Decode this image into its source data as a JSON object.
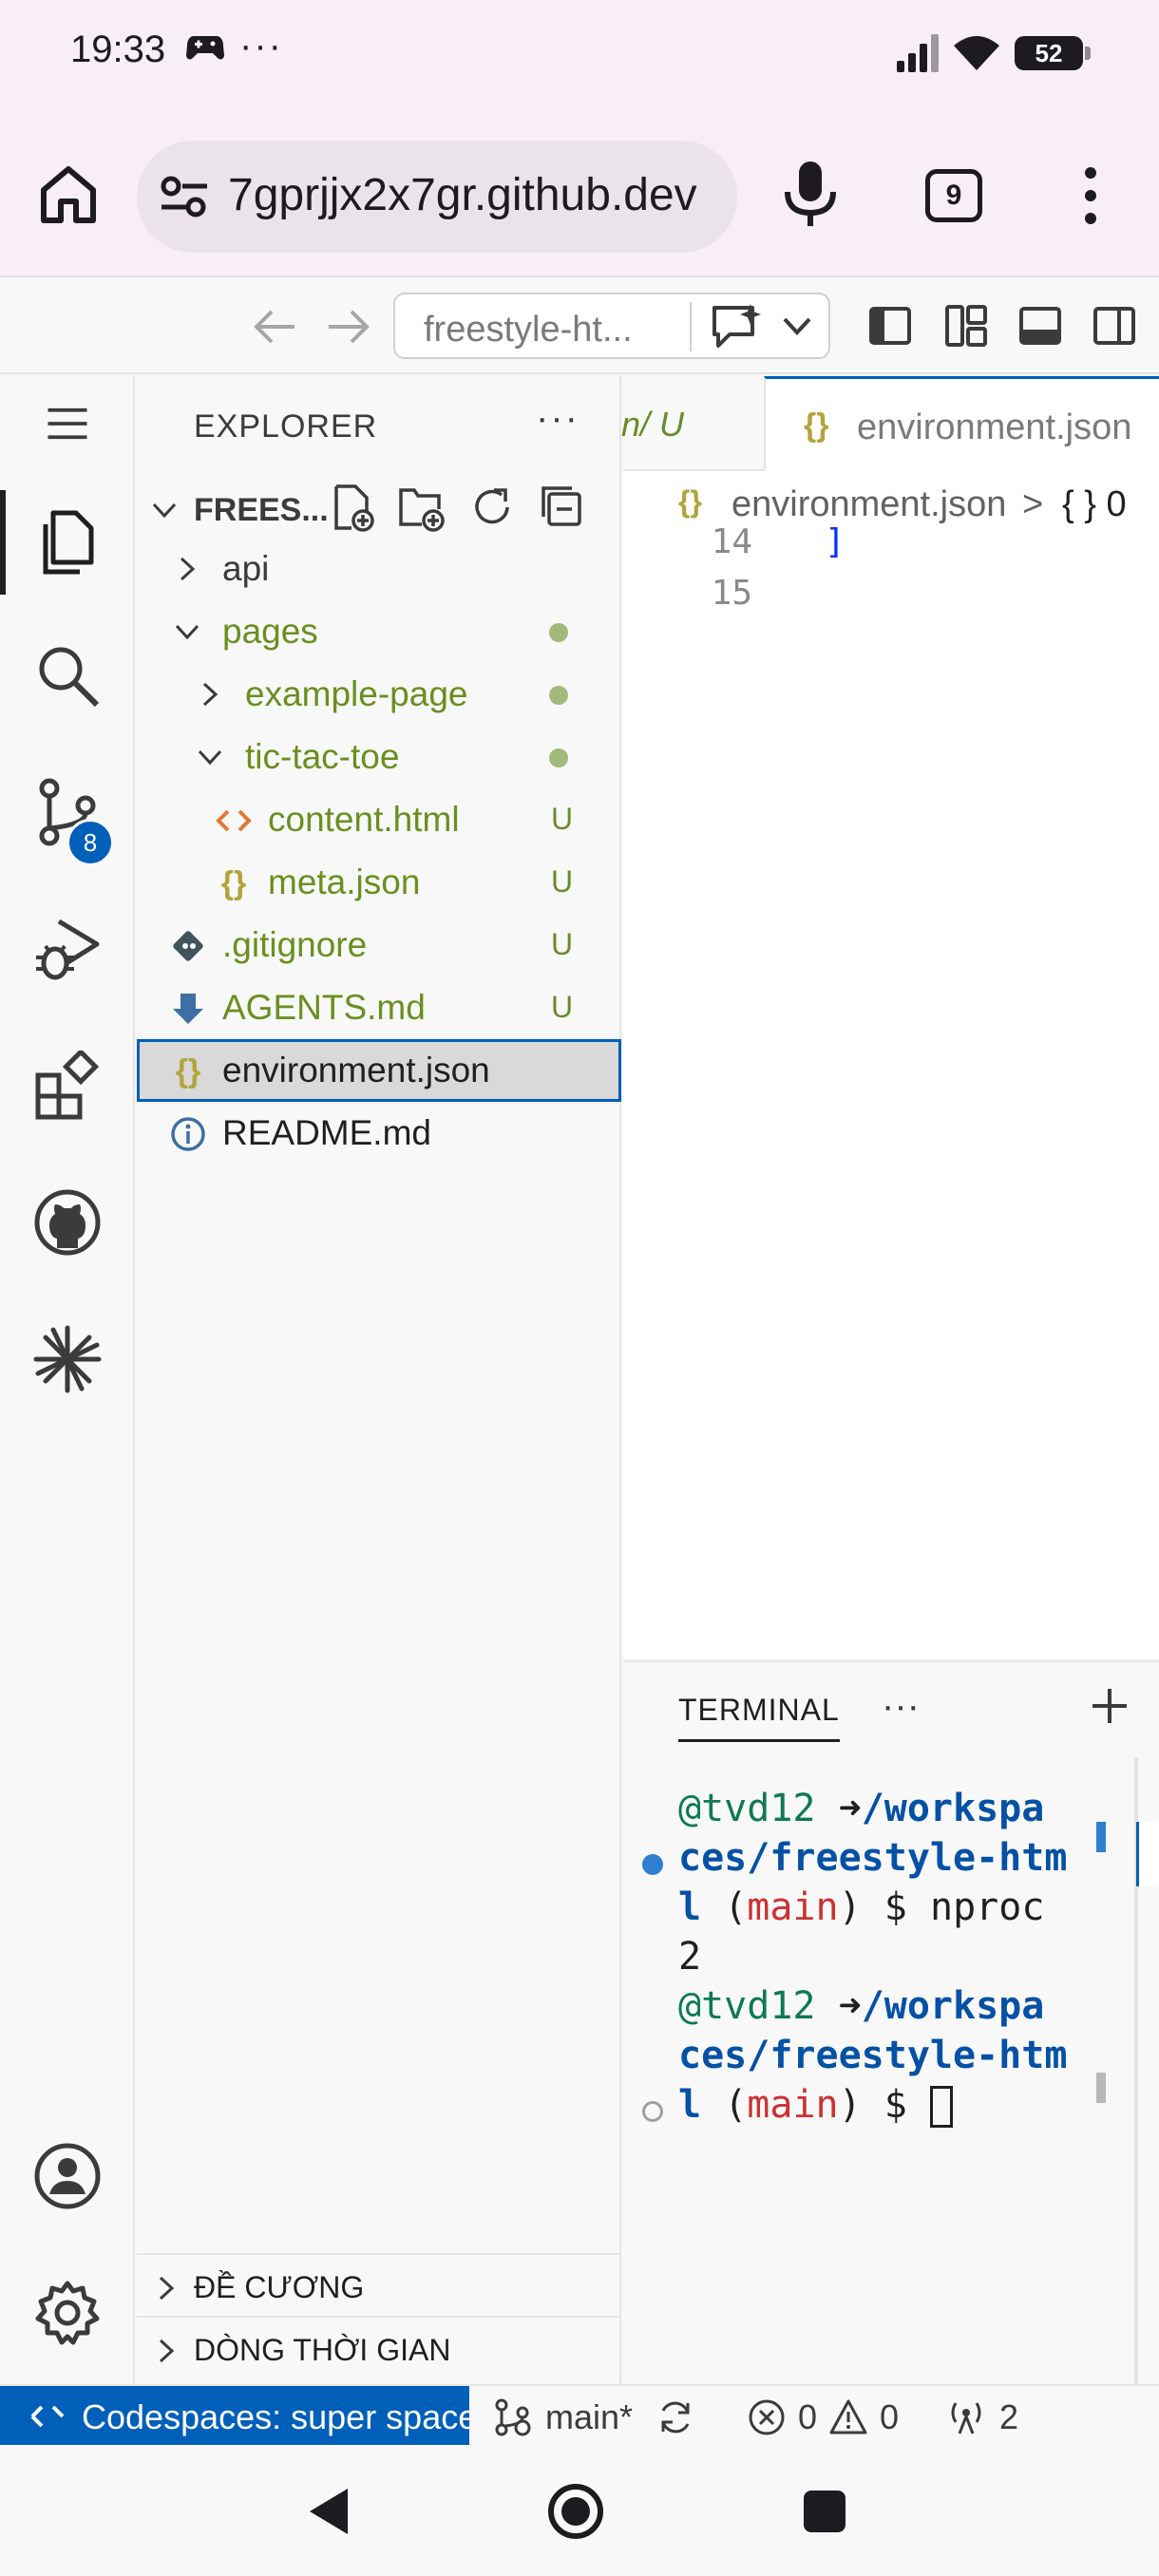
{
  "status_bar": {
    "time": "19:33",
    "overflow": "···",
    "battery": "52"
  },
  "browser": {
    "url": "7gprjjx2x7gr.github.dev",
    "tab_count": "9"
  },
  "command_center": {
    "text": "freestyle-ht..."
  },
  "activity_bar": {
    "source_control_badge": "8"
  },
  "explorer": {
    "header": "EXPLORER",
    "more": "···",
    "section_title": "FREES...",
    "items": [
      {
        "label": "api",
        "status": ""
      },
      {
        "label": "pages",
        "status": ""
      },
      {
        "label": "example-page",
        "status": ""
      },
      {
        "label": "tic-tac-toe",
        "status": ""
      },
      {
        "label": "content.html",
        "status": "U"
      },
      {
        "label": "meta.json",
        "status": "U"
      },
      {
        "label": ".gitignore",
        "status": "U"
      },
      {
        "label": "AGENTS.md",
        "status": "U"
      },
      {
        "label": "environment.json",
        "status": ""
      },
      {
        "label": "README.md",
        "status": ""
      }
    ],
    "outline_title": "ĐỀ CƯƠNG",
    "timeline_title": "DÒNG THỜI GIAN"
  },
  "editor": {
    "partial_tab_label": "n/  U",
    "active_tab_label": "environment.json",
    "breadcrumb_file": "environment.json",
    "breadcrumb_sep": ">",
    "breadcrumb_obj": "{ } 0",
    "lines": [
      {
        "num": "14",
        "text": "]"
      },
      {
        "num": "15",
        "text": ""
      }
    ]
  },
  "panel": {
    "tab": "TERMINAL",
    "more": "···",
    "terminal": {
      "user": "@tvd12",
      "arrow": "➜",
      "path_1": "/workspa",
      "path_2": "ces/freestyle-htm",
      "path_3": "l",
      "branch_open": "(",
      "branch": "main",
      "branch_close": ")",
      "prompt": "$",
      "command": "nproc",
      "output": "2"
    }
  },
  "statusline": {
    "remote": "Codespaces: super space",
    "branch": "main*",
    "errors": "0",
    "warnings": "0",
    "ports": "2"
  },
  "colors": {
    "accent": "#005fb8",
    "git_untracked": "#6a8f1f",
    "json_icon": "#b3a43b",
    "terminal_path": "#0451a5",
    "terminal_branch": "#cd3131"
  }
}
